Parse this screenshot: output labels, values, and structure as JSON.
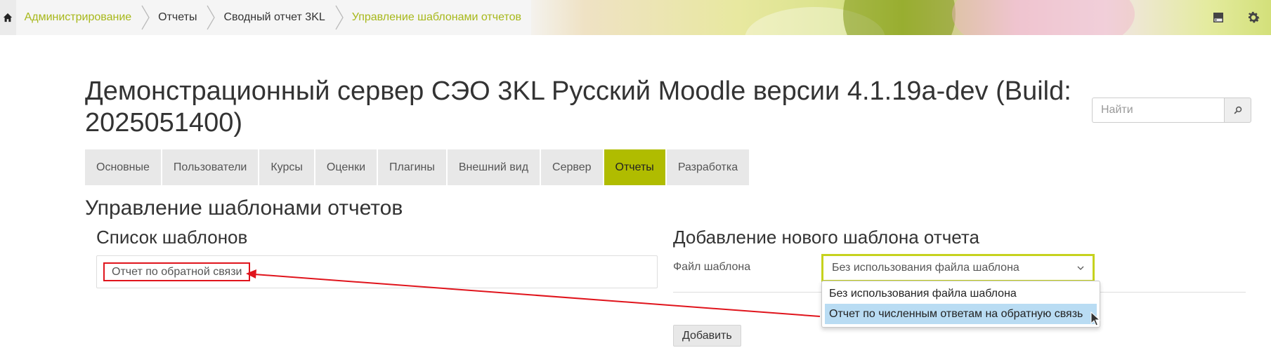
{
  "breadcrumb": {
    "items": [
      {
        "label": "Администрирование",
        "link": true
      },
      {
        "label": "Отчеты",
        "link": false
      },
      {
        "label": "Сводный отчет 3KL",
        "link": false
      },
      {
        "label": "Управление шаблонами отчетов",
        "link": true
      }
    ]
  },
  "header": {
    "site_title": "Демонстрационный сервер СЭО 3KL Русский Moodle версии 4.1.19a-dev (Build: 2025051400)",
    "search_placeholder": "Найти"
  },
  "tabs": [
    {
      "label": "Основные"
    },
    {
      "label": "Пользователи"
    },
    {
      "label": "Курсы"
    },
    {
      "label": "Оценки"
    },
    {
      "label": "Плагины"
    },
    {
      "label": "Внешний вид"
    },
    {
      "label": "Сервер"
    },
    {
      "label": "Отчеты",
      "active": true
    },
    {
      "label": "Разработка"
    }
  ],
  "page": {
    "heading": "Управление шаблонами отчетов",
    "templates_heading": "Список шаблонов",
    "templates": [
      "Отчет по обратной связи"
    ],
    "add_heading": "Добавление нового шаблона отчета",
    "file_label": "Файл шаблона",
    "file_selected": "Без использования файла шаблона",
    "file_options": [
      "Без использования файла шаблона",
      "Отчет по численным ответам на обратную связь"
    ],
    "highlighted_option_index": 1,
    "add_button": "Добавить"
  },
  "colors": {
    "accent": "#b0bc00",
    "link": "#a7b81a",
    "annotation": "#e0141c",
    "option_highlight": "#b9dcf3"
  },
  "icons": {
    "home": "home-icon",
    "save": "sd-card-icon",
    "settings": "gear-icon",
    "search": "search-icon",
    "dropdown": "chevron-down-icon"
  }
}
